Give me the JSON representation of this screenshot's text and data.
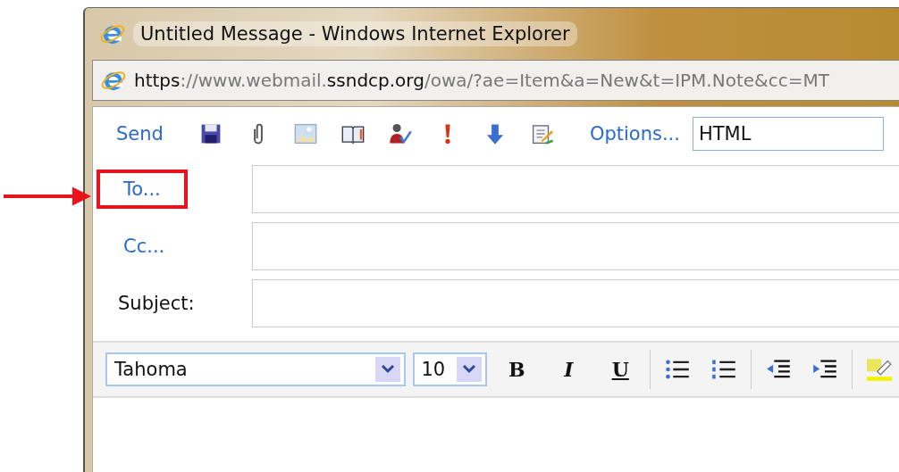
{
  "window": {
    "title": "Untitled Message - Windows Internet Explorer"
  },
  "address_bar": {
    "parts": [
      {
        "text": "https",
        "emphasis": true
      },
      {
        "text": "://www.webmail.",
        "emphasis": false
      },
      {
        "text": "ssndcp.org",
        "emphasis": true
      },
      {
        "text": "/owa/?ae=Item&a=New&t=IPM.Note&cc=MT",
        "emphasis": false
      }
    ]
  },
  "toolbar": {
    "send": "Send",
    "options": "Options...",
    "format": "HTML"
  },
  "fields": [
    {
      "label": "To...",
      "kind": "link",
      "highlighted": true
    },
    {
      "label": "Cc...",
      "kind": "link",
      "highlighted": false
    },
    {
      "label": "Subject:",
      "kind": "plain",
      "highlighted": false
    }
  ],
  "format_bar": {
    "font": "Tahoma",
    "size": "10",
    "buttons": [
      {
        "label": "B",
        "kind": "bold"
      },
      {
        "label": "I",
        "kind": "italic"
      },
      {
        "label": "U",
        "kind": "underline"
      }
    ]
  }
}
